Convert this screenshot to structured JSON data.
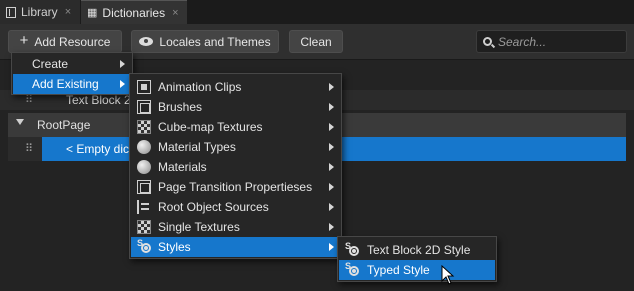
{
  "tabs": [
    {
      "label": "Library",
      "close": "×",
      "icon": "library-icon"
    },
    {
      "label": "Dictionaries",
      "close": "×",
      "icon": "dictionary-icon"
    }
  ],
  "toolbar": {
    "add_resource": "Add Resource",
    "add_resource_icon": "+",
    "locales_themes": "Locales and Themes",
    "clean": "Clean",
    "search_placeholder": "Search..."
  },
  "tree": {
    "textblock_row": "Text Block 2",
    "root_label": "RootPage",
    "empty_row": "< Empty dic"
  },
  "menu_add": {
    "items": [
      {
        "label": "Create"
      },
      {
        "label": "Add Existing"
      }
    ]
  },
  "menu_existing": {
    "items": [
      {
        "label": "Animation Clips",
        "icon": "animation-clip-icon"
      },
      {
        "label": "Brushes",
        "icon": "brush-icon"
      },
      {
        "label": "Cube-map Textures",
        "icon": "cubemap-texture-icon"
      },
      {
        "label": "Material Types",
        "icon": "material-type-icon"
      },
      {
        "label": "Materials",
        "icon": "material-icon"
      },
      {
        "label": "Page Transition Propertieses",
        "icon": "page-transition-icon"
      },
      {
        "label": "Root Object Sources",
        "icon": "root-object-source-icon"
      },
      {
        "label": "Single Textures",
        "icon": "single-texture-icon"
      },
      {
        "label": "Styles",
        "icon": "style-icon"
      }
    ]
  },
  "menu_styles": {
    "items": [
      {
        "label": "Text Block 2D Style",
        "icon": "style-icon"
      },
      {
        "label": "Typed Style",
        "icon": "style-icon"
      }
    ]
  },
  "colors": {
    "accent": "#1677cc",
    "background": "#232323",
    "menu_background": "#262626"
  }
}
